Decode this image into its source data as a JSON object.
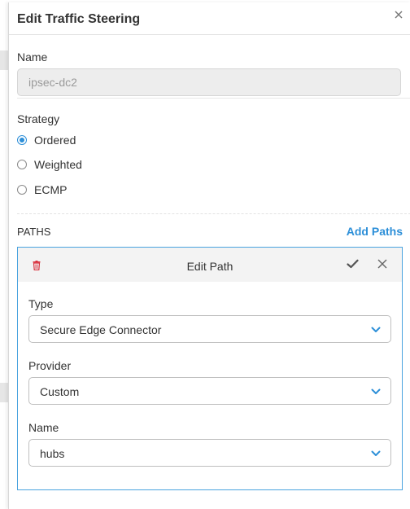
{
  "dialog": {
    "title": "Edit Traffic Steering",
    "name_label": "Name",
    "name_value": "ipsec-dc2",
    "strategy_label": "Strategy",
    "strategy_options": [
      {
        "label": "Ordered",
        "checked": true
      },
      {
        "label": "Weighted",
        "checked": false
      },
      {
        "label": "ECMP",
        "checked": false
      }
    ],
    "paths_label": "PATHS",
    "add_paths_label": "Add Paths"
  },
  "edit_path": {
    "title": "Edit Path",
    "type_label": "Type",
    "type_value": "Secure Edge Connector",
    "provider_label": "Provider",
    "provider_value": "Custom",
    "name_label": "Name",
    "name_value": "hubs"
  },
  "colors": {
    "accent": "#2d8fd8",
    "danger": "#d9333f",
    "card_border": "#4aa3df"
  },
  "icons": {
    "close": "close-icon",
    "trash": "trash-icon",
    "confirm": "checkmark-icon",
    "dropdown": "chevron-down-icon"
  }
}
